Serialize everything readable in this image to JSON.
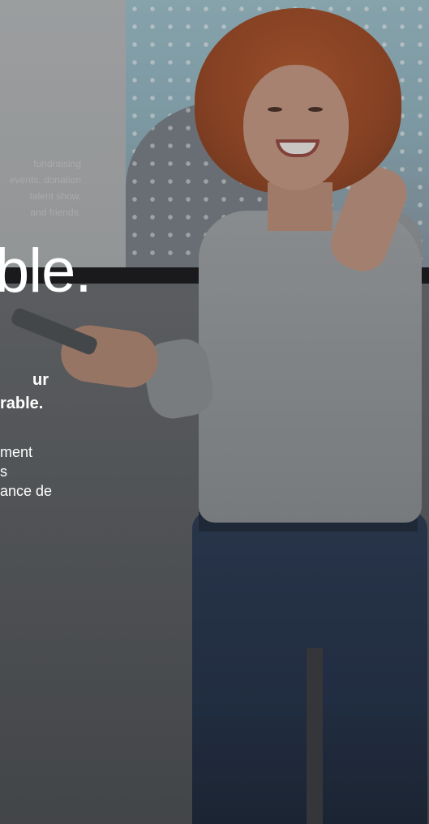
{
  "hero": {
    "background_screen_text": [
      "fundraising",
      "events, donation",
      "talent show,",
      "and friends."
    ],
    "headline": "ble.",
    "subheading": {
      "line1": "ur",
      "line2": "rable."
    },
    "body_lines": [
      "ment",
      "s",
      "ance de"
    ]
  },
  "colors": {
    "text": "#ffffff",
    "screen_blue": "#9fc1cc",
    "hair": "#9c4a26",
    "jeans": "#24324a"
  }
}
